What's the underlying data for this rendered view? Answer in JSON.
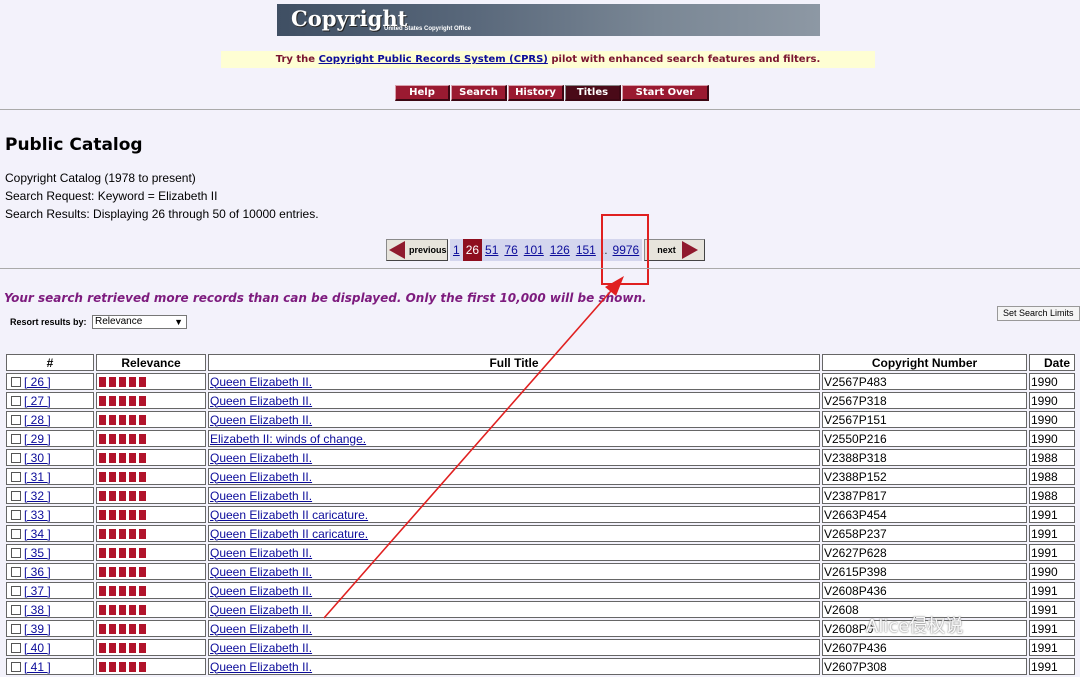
{
  "banner": {
    "logo_text": "Copyright",
    "logo_subtext": "United States Copyright Office"
  },
  "cprs_notice": {
    "prefix": "Try the ",
    "link": "Copyright Public Records System (CPRS)",
    "suffix": " pilot with enhanced search features and filters."
  },
  "nav": {
    "help": "Help",
    "search": "Search",
    "history": "History",
    "titles": "Titles",
    "start_over": "Start Over"
  },
  "page_title": "Public Catalog",
  "catalog": "Copyright Catalog (1978 to present)",
  "search_request": "Search Request: Keyword = Elizabeth II",
  "search_results": "Search Results: Displaying 26 through 50 of 10000 entries.",
  "pager": {
    "previous": "previous",
    "next": "next",
    "pages": [
      "1",
      "26",
      "51",
      "76",
      "101",
      "126",
      "151"
    ],
    "dots": "..",
    "last": "9976"
  },
  "warning": "Your search retrieved more records than can be displayed. Only the first 10,000 will be shown.",
  "resort": {
    "label": "Resort results by:",
    "selected": "Relevance"
  },
  "set_limits": "Set Search Limits",
  "table": {
    "headers": [
      "#",
      "Relevance",
      "Full Title",
      "Copyright Number",
      "Date"
    ],
    "rows": [
      {
        "num": "[ 26 ]",
        "title": "Queen Elizabeth II.",
        "cn": "V2567P483",
        "date": "1990"
      },
      {
        "num": "[ 27 ]",
        "title": "Queen Elizabeth II.",
        "cn": "V2567P318",
        "date": "1990"
      },
      {
        "num": "[ 28 ]",
        "title": "Queen Elizabeth II.",
        "cn": "V2567P151",
        "date": "1990"
      },
      {
        "num": "[ 29 ]",
        "title": "Elizabeth II: winds of change.",
        "cn": "V2550P216",
        "date": "1990"
      },
      {
        "num": "[ 30 ]",
        "title": "Queen Elizabeth II.",
        "cn": "V2388P318",
        "date": "1988"
      },
      {
        "num": "[ 31 ]",
        "title": "Queen Elizabeth II.",
        "cn": "V2388P152",
        "date": "1988"
      },
      {
        "num": "[ 32 ]",
        "title": "Queen Elizabeth II.",
        "cn": "V2387P817",
        "date": "1988"
      },
      {
        "num": "[ 33 ]",
        "title": "Queen Elizabeth II caricature.",
        "cn": "V2663P454",
        "date": "1991"
      },
      {
        "num": "[ 34 ]",
        "title": "Queen Elizabeth II caricature.",
        "cn": "V2658P237",
        "date": "1991"
      },
      {
        "num": "[ 35 ]",
        "title": "Queen Elizabeth II.",
        "cn": "V2627P628",
        "date": "1991"
      },
      {
        "num": "[ 36 ]",
        "title": "Queen Elizabeth II.",
        "cn": "V2615P398",
        "date": "1990"
      },
      {
        "num": "[ 37 ]",
        "title": "Queen Elizabeth II.",
        "cn": "V2608P436",
        "date": "1991"
      },
      {
        "num": "[ 38 ]",
        "title": "Queen Elizabeth II.",
        "cn": "V2608",
        "date": "1991"
      },
      {
        "num": "[ 39 ]",
        "title": "Queen Elizabeth II.",
        "cn": "V2608P0",
        "date": "1991"
      },
      {
        "num": "[ 40 ]",
        "title": "Queen Elizabeth II.",
        "cn": "V2607P436",
        "date": "1991"
      },
      {
        "num": "[ 41 ]",
        "title": "Queen Elizabeth II.",
        "cn": "V2607P308",
        "date": "1991"
      }
    ]
  },
  "watermark": "Alice侵权说",
  "colors": {
    "nav_bg": "#9a1a31",
    "relevance_bar": "#b1132b",
    "link": "#0c0c9a",
    "warning": "#7d1b7e",
    "highlight": "#e02020"
  }
}
